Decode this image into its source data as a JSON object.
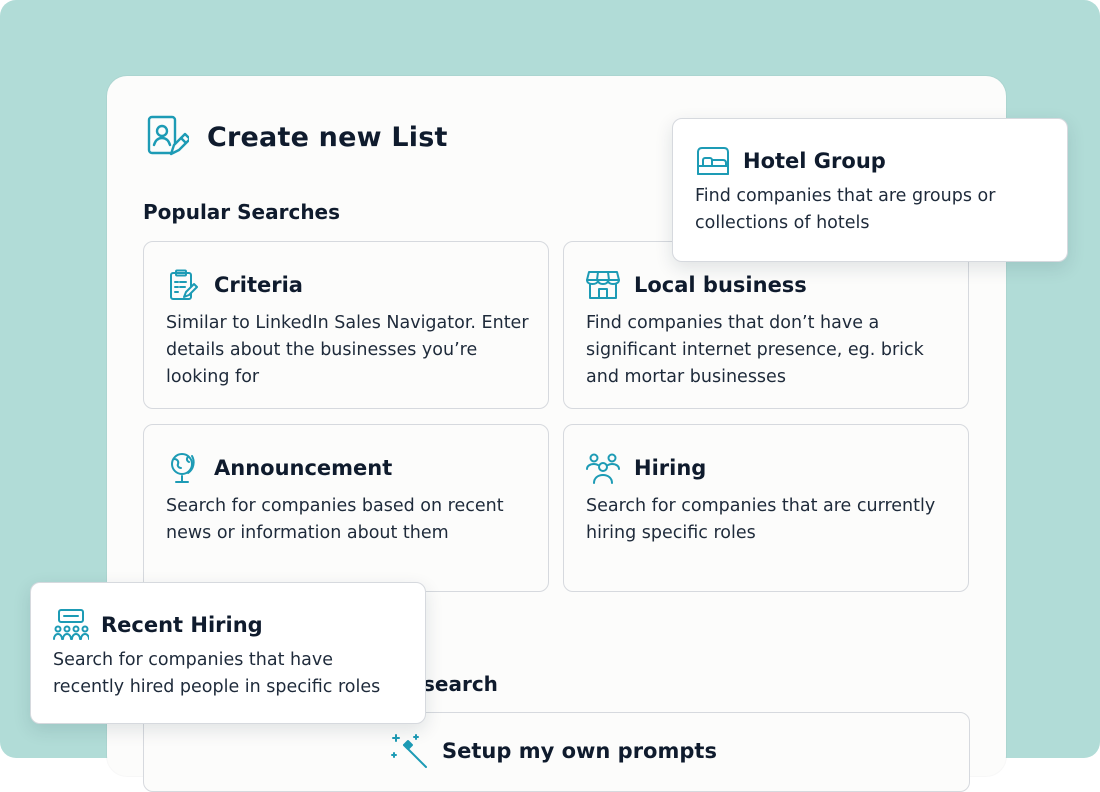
{
  "colors": {
    "backdrop": "#b1dcd7",
    "panel": "#fcfcfb",
    "accent": "#1d9bb5",
    "text": "#0f1b2d"
  },
  "header": {
    "title": "Create new List",
    "icon": "profile-edit-icon"
  },
  "popular": {
    "label": "Popular Searches",
    "cards": [
      {
        "title": "Criteria",
        "icon": "clipboard-edit-icon",
        "desc": "Similar to LinkedIn Sales Navigator. Enter details about the businesses you’re looking for"
      },
      {
        "title": "Local business",
        "icon": "storefront-icon",
        "desc": "Find companies that don’t have a significant internet presence, eg. brick and mortar businesses"
      },
      {
        "title": "Announcement",
        "icon": "globe-icon",
        "desc": "Search for companies based on recent news or information about them"
      },
      {
        "title": "Hiring",
        "icon": "people-group-icon",
        "desc": "Search for companies that are currently hiring specific roles"
      }
    ]
  },
  "custom": {
    "label_fragment": "search",
    "setup": {
      "title": "Setup my own prompts",
      "icon": "magic-wand-icon"
    }
  },
  "floating": {
    "hotel": {
      "title": "Hotel Group",
      "icon": "bed-icon",
      "desc_lines": [
        "Find companies that are groups or",
        "collections of hotels"
      ]
    },
    "recent": {
      "title": "Recent Hiring",
      "icon": "audience-board-icon",
      "desc_lines": [
        "Search for companies that have",
        "recently hired people in specific roles"
      ]
    }
  }
}
